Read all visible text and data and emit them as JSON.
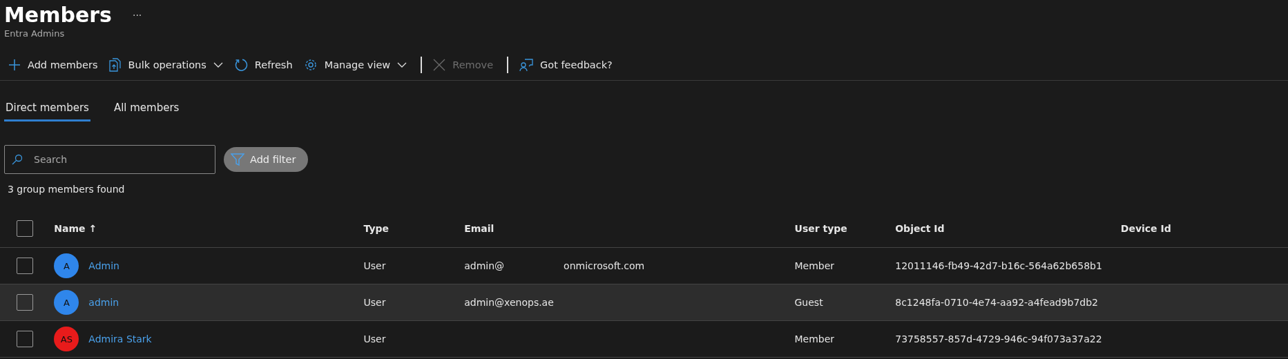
{
  "header": {
    "title": "Members",
    "more": "···",
    "subtitle": "Entra Admins"
  },
  "toolbar": [
    {
      "kind": "add",
      "label": "Add members",
      "disabled": false,
      "dropdown": false
    },
    {
      "kind": "bulk",
      "label": "Bulk operations",
      "disabled": false,
      "dropdown": true
    },
    {
      "kind": "refresh",
      "label": "Refresh",
      "disabled": false,
      "dropdown": false
    },
    {
      "kind": "manage",
      "label": "Manage view",
      "disabled": false,
      "dropdown": true
    },
    {
      "kind": "separator"
    },
    {
      "kind": "remove",
      "label": "Remove",
      "disabled": true,
      "dropdown": false
    },
    {
      "kind": "separator"
    },
    {
      "kind": "feedback",
      "label": "Got feedback?",
      "disabled": false,
      "dropdown": false
    }
  ],
  "tabs": [
    {
      "label": "Direct members",
      "selected": true
    },
    {
      "label": "All members",
      "selected": false
    }
  ],
  "search": {
    "placeholder": "Search"
  },
  "filter_button": "Add filter",
  "result_count": "3 group members found",
  "table": {
    "select_all_checked": false,
    "columns": [
      {
        "label": "Name",
        "sort": "↑"
      },
      {
        "label": "Type"
      },
      {
        "label": "Email"
      },
      {
        "label": "User type"
      },
      {
        "label": "Object Id"
      },
      {
        "label": "Device Id"
      }
    ],
    "rows": [
      {
        "checked": false,
        "highlighted": false,
        "initials": "A",
        "color": "#2f86eb",
        "name": "Admin",
        "type": "User",
        "email": [
          "admin@",
          "onmicrosoft.com"
        ],
        "user_type": "Member",
        "object_id": "12011146-fb49-42d7-b16c-564a62b658b1"
      },
      {
        "checked": false,
        "highlighted": true,
        "initials": "A",
        "color": "#2f86eb",
        "name": "admin",
        "type": "User",
        "email": [
          "admin@xenops.ae"
        ],
        "user_type": "Guest",
        "object_id": "8c1248fa-0710-4e74-aa92-a4fead9b7db2"
      },
      {
        "checked": false,
        "highlighted": false,
        "initials": "AS",
        "color": "#e81b1b",
        "name": "Admira Stark",
        "type": "User",
        "email": [],
        "user_type": "Member",
        "object_id": "73758557-857d-4729-946c-94f073a37a22"
      }
    ]
  }
}
